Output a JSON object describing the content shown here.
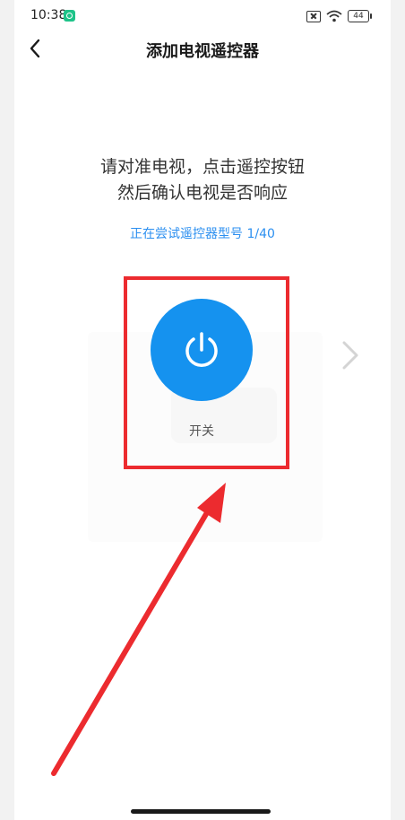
{
  "status_bar": {
    "time": "10:38",
    "battery": "44",
    "app_icon": "app-notification-icon",
    "icons": [
      "sim-off-icon",
      "wifi-icon",
      "battery-icon"
    ]
  },
  "header": {
    "title": "添加电视遥控器",
    "back_icon": "chevron-left-icon"
  },
  "main": {
    "instruction_line1": "请对准电视，点击遥控按钮",
    "instruction_line2": "然后确认电视是否响应",
    "model_status": "正在尝试遥控器型号 1/40",
    "power_label": "开关",
    "power_icon": "power-icon",
    "next_icon": "chevron-right-icon"
  },
  "colors": {
    "accent": "#1592ef",
    "link": "#2b8ff0",
    "annotation": "#ec2b2f"
  }
}
